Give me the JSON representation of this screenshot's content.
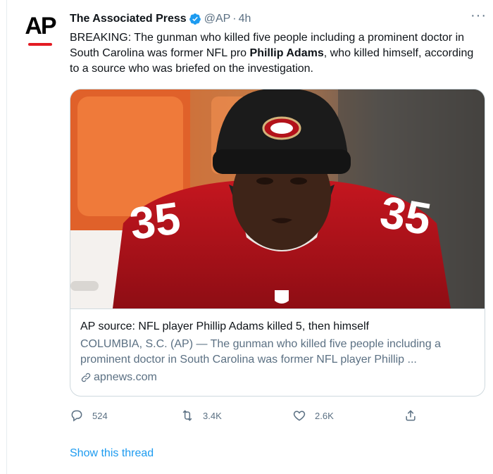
{
  "author": {
    "name": "The Associated Press",
    "handle": "@AP",
    "separator": "·",
    "time": "4h",
    "avatar_text": "AP",
    "verified": true
  },
  "tweet": {
    "text_before": "BREAKING: The gunman who killed five people including a prominent doctor in South Carolina was former NFL pro ",
    "text_bold": "Phillip Adams",
    "text_after": ", who killed himself, according to a source who was briefed on the investigation."
  },
  "card": {
    "title": "AP source: NFL player Phillip Adams killed 5, then himself",
    "description": "COLUMBIA, S.C. (AP) — The gunman who killed five people including a prominent doctor in South Carolina was former NFL player Phillip ...",
    "domain": "apnews.com",
    "image_alt": "Football player in red #35 jersey and black knit cap with team logo"
  },
  "actions": {
    "reply_count": "524",
    "retweet_count": "3.4K",
    "like_count": "2.6K"
  },
  "thread_link": "Show this thread",
  "colors": {
    "accent": "#1d9bf0",
    "secondary_text": "#5b7083",
    "border": "#cfd9de",
    "jersey_red": "#b3121a"
  },
  "icons": [
    "verified-badge-icon",
    "more-icon",
    "link-icon",
    "reply-icon",
    "retweet-icon",
    "like-icon",
    "share-icon"
  ]
}
